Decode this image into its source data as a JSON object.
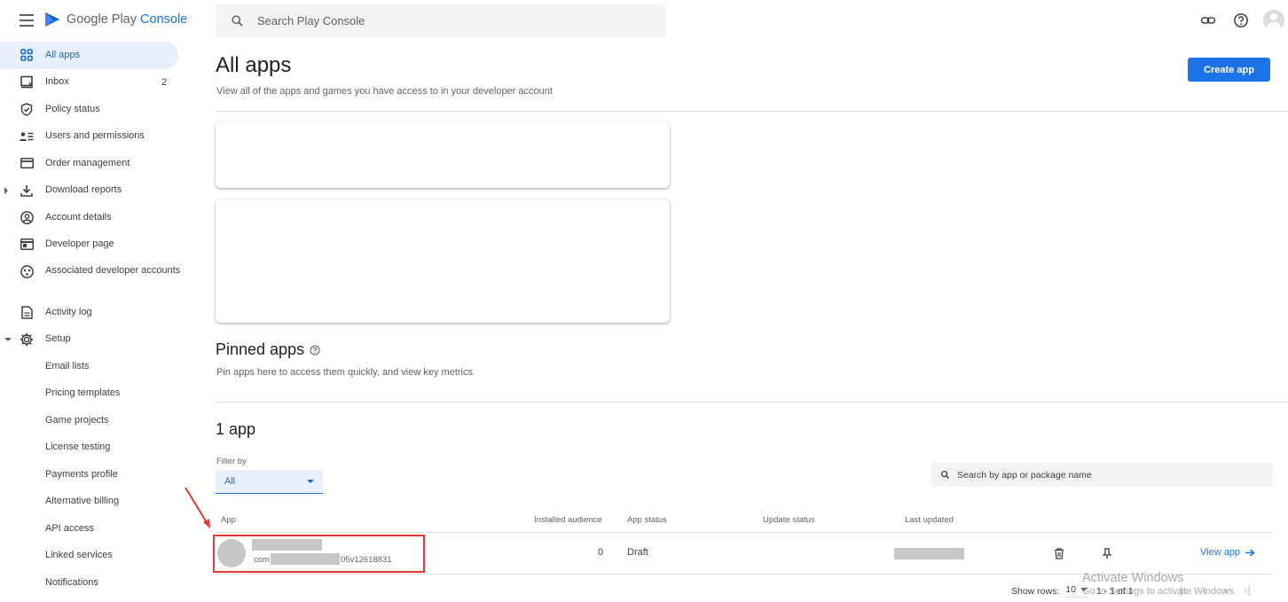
{
  "topbar": {
    "logo_text_main": "Google Play",
    "logo_text_accent": "Console",
    "search_placeholder": "Search Play Console"
  },
  "sidebar": {
    "items": [
      {
        "label": "All apps",
        "icon": "grid-icon",
        "active": true
      },
      {
        "label": "Inbox",
        "icon": "inbox-icon",
        "count": "2"
      },
      {
        "label": "Policy status",
        "icon": "shield-icon"
      },
      {
        "label": "Users and permissions",
        "icon": "users-permissions-icon"
      },
      {
        "label": "Order management",
        "icon": "credit-card-icon"
      },
      {
        "label": "Download reports",
        "icon": "download-icon",
        "expandable": "collapsed"
      },
      {
        "label": "Account details",
        "icon": "account-circle-icon"
      },
      {
        "label": "Developer page",
        "icon": "web-page-icon"
      },
      {
        "label": "Associated developer accounts",
        "icon": "linked-accounts-icon"
      },
      {
        "label": "Activity log",
        "icon": "document-icon"
      },
      {
        "label": "Setup",
        "icon": "gear-icon",
        "expandable": "expanded"
      },
      {
        "label": "Email lists"
      },
      {
        "label": "Pricing templates"
      },
      {
        "label": "Game projects"
      },
      {
        "label": "License testing"
      },
      {
        "label": "Payments profile"
      },
      {
        "label": "Alternative billing"
      },
      {
        "label": "API access"
      },
      {
        "label": "Linked services"
      },
      {
        "label": "Notifications"
      }
    ]
  },
  "main": {
    "title": "All apps",
    "subtitle": "View all of the apps and games you have access to in your developer account",
    "create_button": "Create app",
    "pinned": {
      "title": "Pinned apps",
      "description": "Pin apps here to access them quickly, and view key metrics"
    },
    "apps_section": {
      "title": "1 app",
      "filter_label": "Filter by",
      "filter_value": "All",
      "search_placeholder": "Search by app or package name"
    },
    "table": {
      "columns": [
        "App",
        "Installed audience",
        "App status",
        "Update status",
        "Last updated"
      ],
      "rows": [
        {
          "package_prefix": "com",
          "package_suffix": "05v12618831",
          "installed_audience": "0",
          "app_status": "Draft",
          "update_status": "",
          "view_link": "View app"
        }
      ]
    },
    "pagination": {
      "show_rows_label": "Show rows:",
      "rows_value": "10",
      "range": "1 - 1 of 1"
    }
  },
  "watermark": {
    "line1": "Activate Windows",
    "line2": "Go to Settings to activate Windows."
  },
  "colors": {
    "accent": "#1a73e8",
    "active_nav_bg": "#e8f0fe",
    "highlight_box": "#e53935"
  }
}
